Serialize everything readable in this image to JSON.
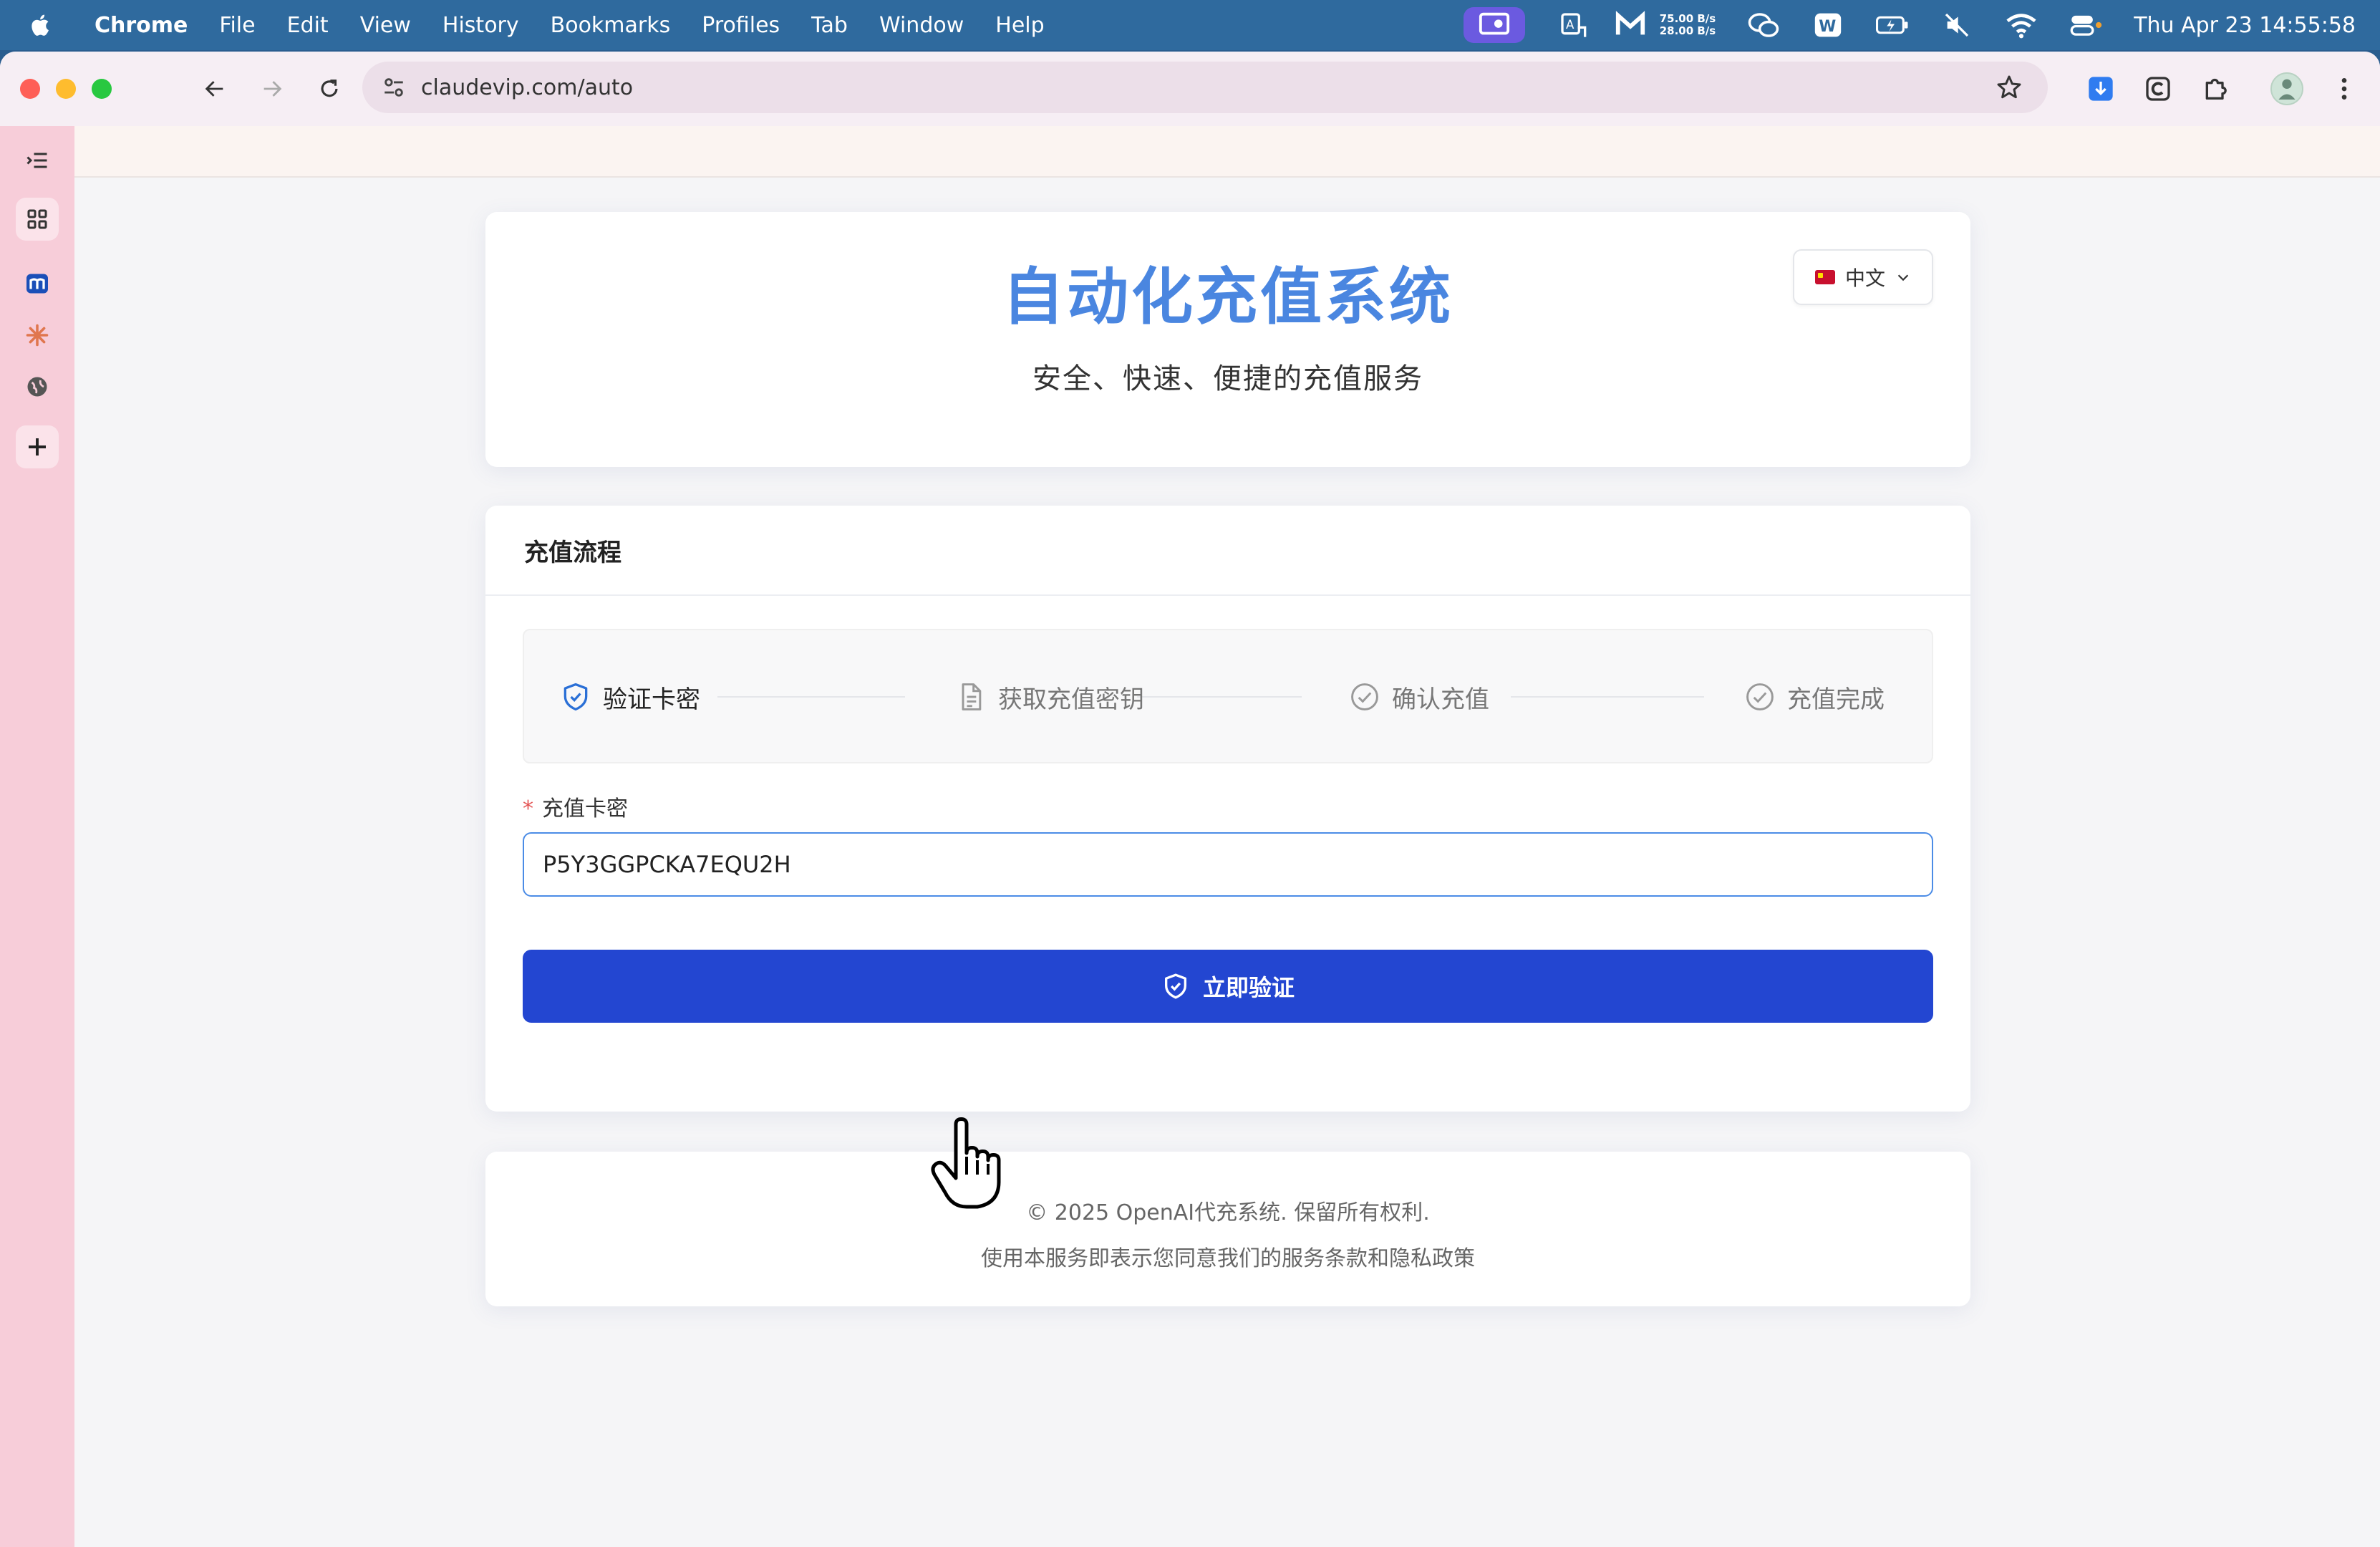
{
  "menubar": {
    "app_name": "Chrome",
    "menus": [
      "File",
      "Edit",
      "View",
      "History",
      "Bookmarks",
      "Profiles",
      "Tab",
      "Window",
      "Help"
    ],
    "net_up": "75.00 B/s",
    "net_down": "28.00 B/s",
    "clock": "Thu Apr 23  14:55:58"
  },
  "browser": {
    "url": "claudevip.com/auto"
  },
  "hero": {
    "title": "自动化充值系统",
    "subtitle": "安全、快速、便捷的充值服务",
    "language": "中文"
  },
  "flow": {
    "header": "充值流程",
    "steps": [
      {
        "label": "验证卡密",
        "icon": "shield-check-icon",
        "active": true
      },
      {
        "label": "获取充值密钥",
        "icon": "document-icon",
        "active": false
      },
      {
        "label": "确认充值",
        "icon": "check-circle-icon",
        "active": false
      },
      {
        "label": "充值完成",
        "icon": "check-circle-icon",
        "active": false
      }
    ],
    "field_required_mark": "*",
    "field_label": "充值卡密",
    "field_value": "P5Y3GGPCKA7EQU2H",
    "submit_label": "立即验证"
  },
  "footer": {
    "copyright": "© 2025 OpenAI代充系统. 保留所有权利.",
    "notice": "使用本服务即表示您同意我们的服务条款和隐私政策"
  },
  "colors": {
    "title_blue": "#4a86e0",
    "button_blue": "#2346d1",
    "input_border": "#4b8ce6",
    "active_step_icon": "#2a6fd6",
    "sidebar_pink": "#f7cdd9"
  }
}
